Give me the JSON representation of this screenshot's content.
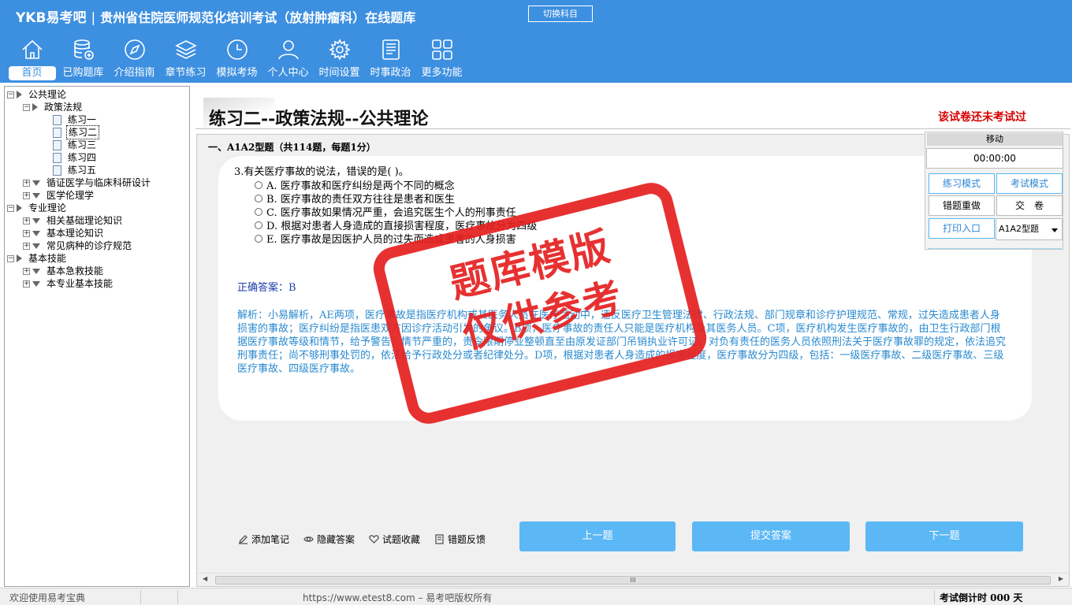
{
  "header": {
    "logo": "YKB易考吧",
    "separator": "|",
    "title": "贵州省住院医师规范化培训考试（放射肿瘤科）在线题库",
    "switch_button": "切换科目"
  },
  "nav": [
    {
      "label": "首页",
      "icon": "home-icon"
    },
    {
      "label": "已购题库",
      "icon": "database-icon"
    },
    {
      "label": "介绍指南",
      "icon": "compass-icon"
    },
    {
      "label": "章节练习",
      "icon": "layers-icon"
    },
    {
      "label": "模拟考场",
      "icon": "clock-icon"
    },
    {
      "label": "个人中心",
      "icon": "user-icon"
    },
    {
      "label": "时间设置",
      "icon": "gear-icon"
    },
    {
      "label": "时事政治",
      "icon": "news-icon"
    },
    {
      "label": "更多功能",
      "icon": "grid-icon"
    }
  ],
  "tree": {
    "public_theory": "公共理论",
    "policy": "政策法规",
    "exercises": [
      "练习一",
      "练习二",
      "练习三",
      "练习四",
      "练习五"
    ],
    "evidence": "循证医学与临床科研设计",
    "ethics": "医学伦理学",
    "professional": "专业理论",
    "basic_knowledge": "相关基础理论知识",
    "basic_theory": "基本理论知识",
    "common_disease": "常见病种的诊疗规范",
    "basic_skills": "基本技能",
    "first_aid": "基本急救技能",
    "specialty_skills": "本专业基本技能"
  },
  "main": {
    "title": "练习二--政策法规--公共理论",
    "status": "该试卷还未考试过",
    "section": "一、A1A2型题（共114题，每题1分）",
    "question": "3.有关医疗事故的说法，错误的是( )。",
    "options": [
      "A. 医疗事故和医疗纠纷是两个不同的概念",
      "B. 医疗事故的责任双方往往是患者和医生",
      "C. 医疗事故如果情况严重，会追究医生个人的刑事责任",
      "D. 根据对患者人身造成的直接损害程度，医疗事故分为四级",
      "E. 医疗事故是因医护人员的过失而造成患者的人身损害"
    ],
    "answer": "正确答案：B",
    "analysis": "解析：小易解析，AE两项，医疗事故是指医疗机构或其医务人员在医疗活动中，违反医疗卫生管理法律、行政法规、部门规章和诊疗护理规范、常规，过失造成患者人身损害的事故；医疗纠纷是指医患双方因诊疗活动引发的争议。B项，医疗事故的责任人只能是医疗机构及其医务人员。C项，医疗机构发生医疗事故的，由卫生行政部门根据医疗事故等级和情节，给予警告；情节严重的，责令限期停业整顿直至由原发证部门吊销执业许可证，对负有责任的医务人员依照刑法关于医疗事故罪的规定，依法追究刑事责任；尚不够刑事处罚的，依法给予行政处分或者纪律处分。D项，根据对患者人身造成的损害程度，医疗事故分为四级，包括：一级医疗事故、二级医疗事故、三级医疗事故、四级医疗事故。",
    "stamp": [
      "题库模版",
      "仅供参考"
    ],
    "tools": [
      "添加笔记",
      "隐藏答案",
      "试题收藏",
      "错题反馈"
    ],
    "prev": "上一题",
    "submit": "提交答案",
    "next": "下一题",
    "scroll_thumb": "III"
  },
  "panel": {
    "move": "移动",
    "timer": "00:00:00",
    "practice_mode": "练习模式",
    "exam_mode": "考试模式",
    "redo_wrong": "错题重做",
    "submit_paper": "交　卷",
    "print": "打印入口",
    "question_type": "A1A2型题"
  },
  "status": {
    "welcome": "欢迎使用易考宝典",
    "copyright": "https://www.etest8.com – 易考吧版权所有",
    "countdown": "考试倒计时 000 天"
  },
  "colors": {
    "header": "#3d8fe0",
    "button": "#5bb8f5",
    "stamp": "#e52020",
    "analysis": "#2a8ad0"
  }
}
